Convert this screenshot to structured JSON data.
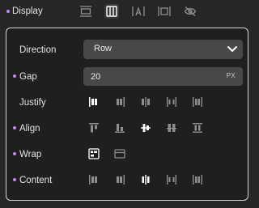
{
  "display": {
    "label": "Display",
    "options": [
      {
        "icon": "block-icon",
        "active": false
      },
      {
        "icon": "flex-icon",
        "active": true
      },
      {
        "icon": "inline-text-icon",
        "active": false
      },
      {
        "icon": "inline-block-icon",
        "active": false
      },
      {
        "icon": "hidden-eye-icon",
        "active": false
      }
    ]
  },
  "direction": {
    "label": "Direction",
    "value": "Row"
  },
  "gap": {
    "label": "Gap",
    "value": "20",
    "unit": "PX"
  },
  "justify": {
    "label": "Justify",
    "selected_index": 0
  },
  "align": {
    "label": "Align",
    "selected_index": 2
  },
  "wrap": {
    "label": "Wrap",
    "selected_index": 0
  },
  "content": {
    "label": "Content",
    "selected_index": 2
  },
  "colors": {
    "accent": "#b78df2",
    "active_icon": "#ffffff",
    "inactive_icon": "#8e8e8e"
  }
}
